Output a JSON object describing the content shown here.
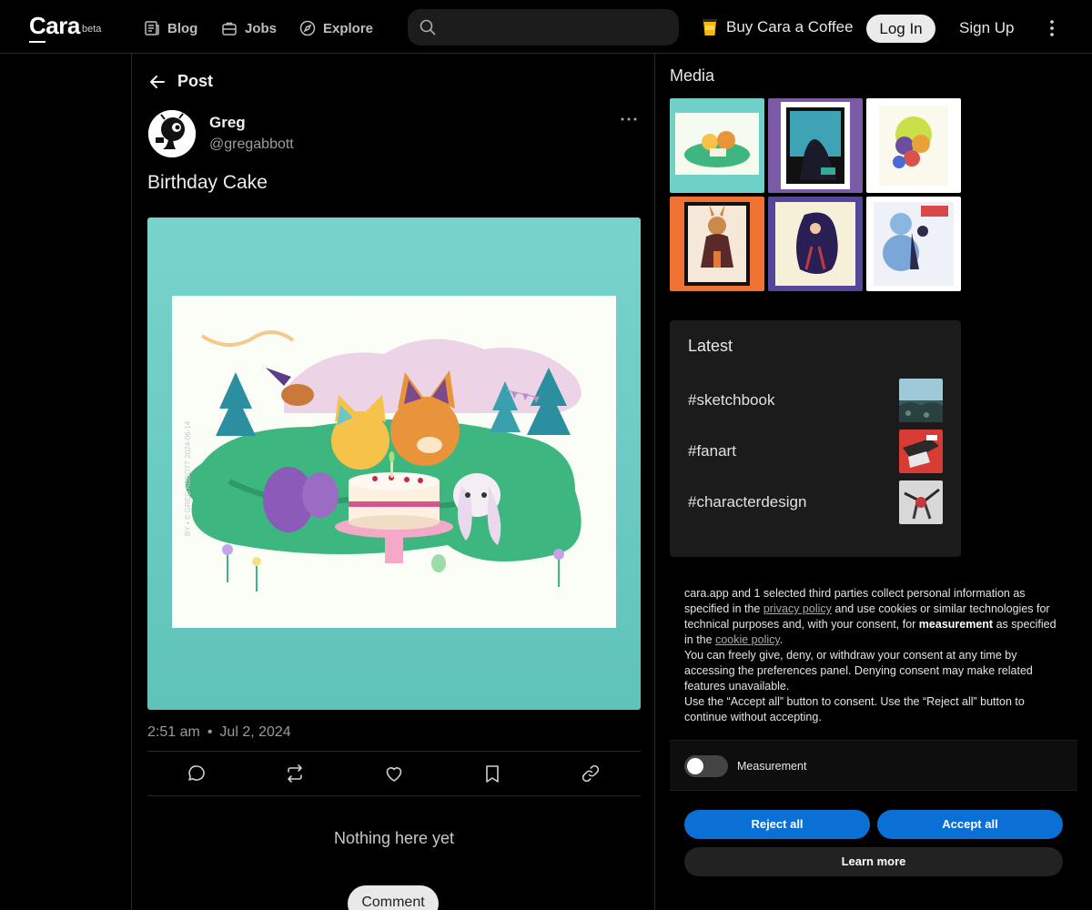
{
  "header": {
    "logo": "Cara",
    "logo_badge": "beta",
    "nav": [
      {
        "label": "Blog",
        "icon": "newspaper-icon"
      },
      {
        "label": "Jobs",
        "icon": "briefcase-icon"
      },
      {
        "label": "Explore",
        "icon": "compass-icon"
      }
    ],
    "search": {
      "placeholder": "",
      "value": ""
    },
    "coffee_label": "Buy Cara a Coffee",
    "login_label": "Log In",
    "signup_label": "Sign Up"
  },
  "post": {
    "back_label": "Post",
    "author_name": "Greg",
    "author_handle": "@gregabbott",
    "title": "Birthday Cake",
    "time": "2:51 am",
    "separator": "•",
    "date": "Jul 2, 2024",
    "image_caption": "BY • © GREG ABBOTT 2024-06-14",
    "empty_text": "Nothing here yet",
    "comment_label": "Comment"
  },
  "media": {
    "title": "Media",
    "thumbs": [
      {
        "name": "media-thumb-birthday"
      },
      {
        "name": "media-thumb-window"
      },
      {
        "name": "media-thumb-characters"
      },
      {
        "name": "media-thumb-rabbit"
      },
      {
        "name": "media-thumb-silhouette"
      },
      {
        "name": "media-thumb-bears"
      }
    ]
  },
  "latest": {
    "title": "Latest",
    "tags": [
      {
        "label": "#sketchbook"
      },
      {
        "label": "#fanart"
      },
      {
        "label": "#characterdesign"
      }
    ]
  },
  "consent": {
    "p1_a": "cara.app and 1 selected third parties collect personal information as specified in the ",
    "privacy_link": "privacy policy",
    "p1_b": " and use cookies or similar technologies for technical purposes and, with your consent, for ",
    "p1_bold": "measurement",
    "p1_c": " as specified in the ",
    "cookie_link": "cookie policy",
    "p1_d": ".",
    "p2": "You can freely give, deny, or withdraw your consent at any time by accessing the preferences panel. Denying consent may make related features unavailable.",
    "p3": "Use the “Accept all” button to consent. Use the “Reject all” button to continue without accepting.",
    "toggle_label": "Measurement",
    "reject_label": "Reject all",
    "accept_label": "Accept all",
    "learn_label": "Learn more"
  },
  "colors": {
    "background": "#000000",
    "accent_blue": "#0a70d6",
    "image_teal": "#6ccfc7"
  }
}
